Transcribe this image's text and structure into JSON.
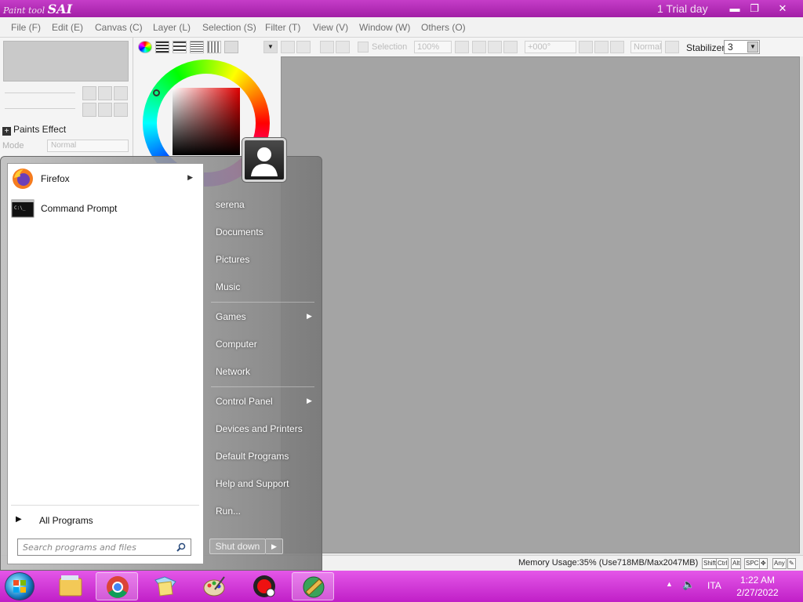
{
  "app": {
    "logo_small": "Paint tool",
    "logo_big": "SAI",
    "trial": "1 Trial day",
    "window_buttons": [
      "minimize-icon",
      "restore-icon",
      "close-icon"
    ]
  },
  "menu": [
    {
      "label": "File (F)"
    },
    {
      "label": "Edit (E)"
    },
    {
      "label": "Canvas (C)"
    },
    {
      "label": "Layer (L)"
    },
    {
      "label": "Selection (S)"
    },
    {
      "label": "Filter (T)"
    },
    {
      "label": "View (V)"
    },
    {
      "label": "Window (W)"
    },
    {
      "label": "Others (O)"
    }
  ],
  "left_panel": {
    "paints_effect": "Paints Effect",
    "mode_label": "Mode",
    "mode_value": "Normal"
  },
  "toolbar": {
    "selection_label": "Selection",
    "zoom": "100%",
    "rotation": "+000°",
    "blend": "Normal",
    "stabilizer_label": "Stabilizer",
    "stabilizer_value": "3"
  },
  "status": {
    "memory": "Memory Usage:35% (Use718MB/Max2047MB)",
    "keys": [
      "Shift",
      "Ctrl",
      "Alt",
      "SPC",
      "✥",
      "Any",
      "✎"
    ]
  },
  "start_menu": {
    "pinned": [
      {
        "label": "Firefox",
        "icon": "firefox-icon",
        "has_submenu": true
      },
      {
        "label": "Command Prompt",
        "icon": "command-prompt-icon",
        "has_submenu": false
      }
    ],
    "all_programs": "All Programs",
    "search_placeholder": "Search programs and files",
    "right_items": [
      {
        "label": "serena",
        "has_submenu": false
      },
      {
        "label": "Documents",
        "has_submenu": false
      },
      {
        "label": "Pictures",
        "has_submenu": false
      },
      {
        "label": "Music",
        "has_submenu": false
      },
      {
        "label": "Games",
        "has_submenu": true
      },
      {
        "label": "Computer",
        "has_submenu": false
      },
      {
        "label": "Network",
        "has_submenu": false
      },
      {
        "label": "Control Panel",
        "has_submenu": true
      },
      {
        "label": "Devices and Printers",
        "has_submenu": false
      },
      {
        "label": "Default Programs",
        "has_submenu": false
      },
      {
        "label": "Help and Support",
        "has_submenu": false
      },
      {
        "label": "Run...",
        "has_submenu": false
      }
    ],
    "shutdown": "Shut down"
  },
  "taskbar": {
    "apps": [
      "explorer-icon",
      "chrome-icon",
      "folder-icon",
      "paint-icon",
      "recorder-icon",
      "paint-tool-sai-icon"
    ],
    "language": "ITA",
    "time": "1:22 AM",
    "date": "2/27/2022"
  }
}
